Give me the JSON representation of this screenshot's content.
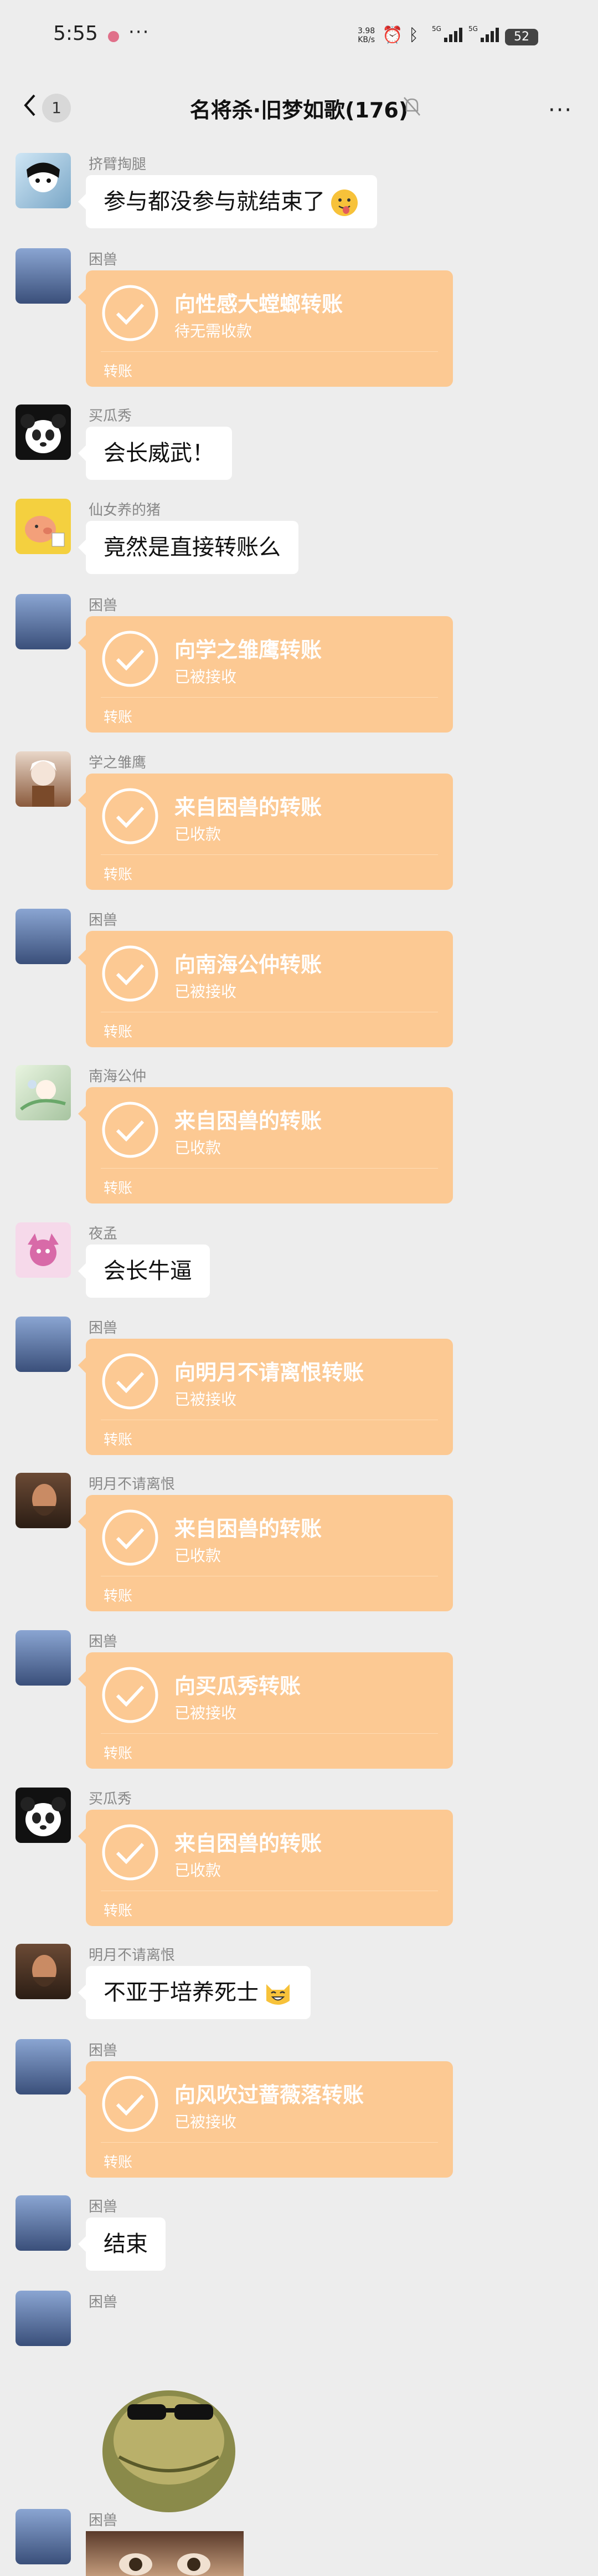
{
  "status_bar": {
    "time": "5:55",
    "more": "···",
    "speed": "3.98\nKB/s",
    "battery": "52",
    "signal_label": "5G"
  },
  "header": {
    "unread": "1",
    "title": "名将杀·旧梦如歌(176)",
    "more": "···"
  },
  "transfer_label": "转账",
  "messages": [
    {
      "sender": "挤臂掏腿",
      "text": "参与都没参与就结束了"
    },
    {
      "sender": "困兽",
      "title": "向性感大螳螂转账",
      "status": "待无需收款"
    },
    {
      "sender": "买瓜秀",
      "text": "会长威武！"
    },
    {
      "sender": "仙女养的猪",
      "text": "竟然是直接转账么"
    },
    {
      "sender": "困兽",
      "title": "向学之雏鹰转账",
      "status": "已被接收"
    },
    {
      "sender": "学之雏鹰",
      "title": "来自困兽的转账",
      "status": "已收款"
    },
    {
      "sender": "困兽",
      "title": "向南海公仲转账",
      "status": "已被接收"
    },
    {
      "sender": "南海公仲",
      "title": "来自困兽的转账",
      "status": "已收款"
    },
    {
      "sender": "夜孟",
      "text": "会长牛逼"
    },
    {
      "sender": "困兽",
      "title": "向明月不请离恨转账",
      "status": "已被接收"
    },
    {
      "sender": "明月不请离恨",
      "title": "来自困兽的转账",
      "status": "已收款"
    },
    {
      "sender": "困兽",
      "title": "向买瓜秀转账",
      "status": "已被接收"
    },
    {
      "sender": "买瓜秀",
      "title": "来自困兽的转账",
      "status": "已收款"
    },
    {
      "sender": "明月不请离恨",
      "text": "不亚于培养死士"
    },
    {
      "sender": "困兽",
      "title": "向风吹过蔷薇落转账",
      "status": "已被接收"
    },
    {
      "sender": "困兽",
      "text": "结束"
    },
    {
      "sender": "困兽"
    },
    {
      "sender": "困兽"
    }
  ],
  "colors": {
    "background": "#ededed",
    "transfer_bubble": "#fcc993",
    "text_bubble": "#ffffff"
  }
}
